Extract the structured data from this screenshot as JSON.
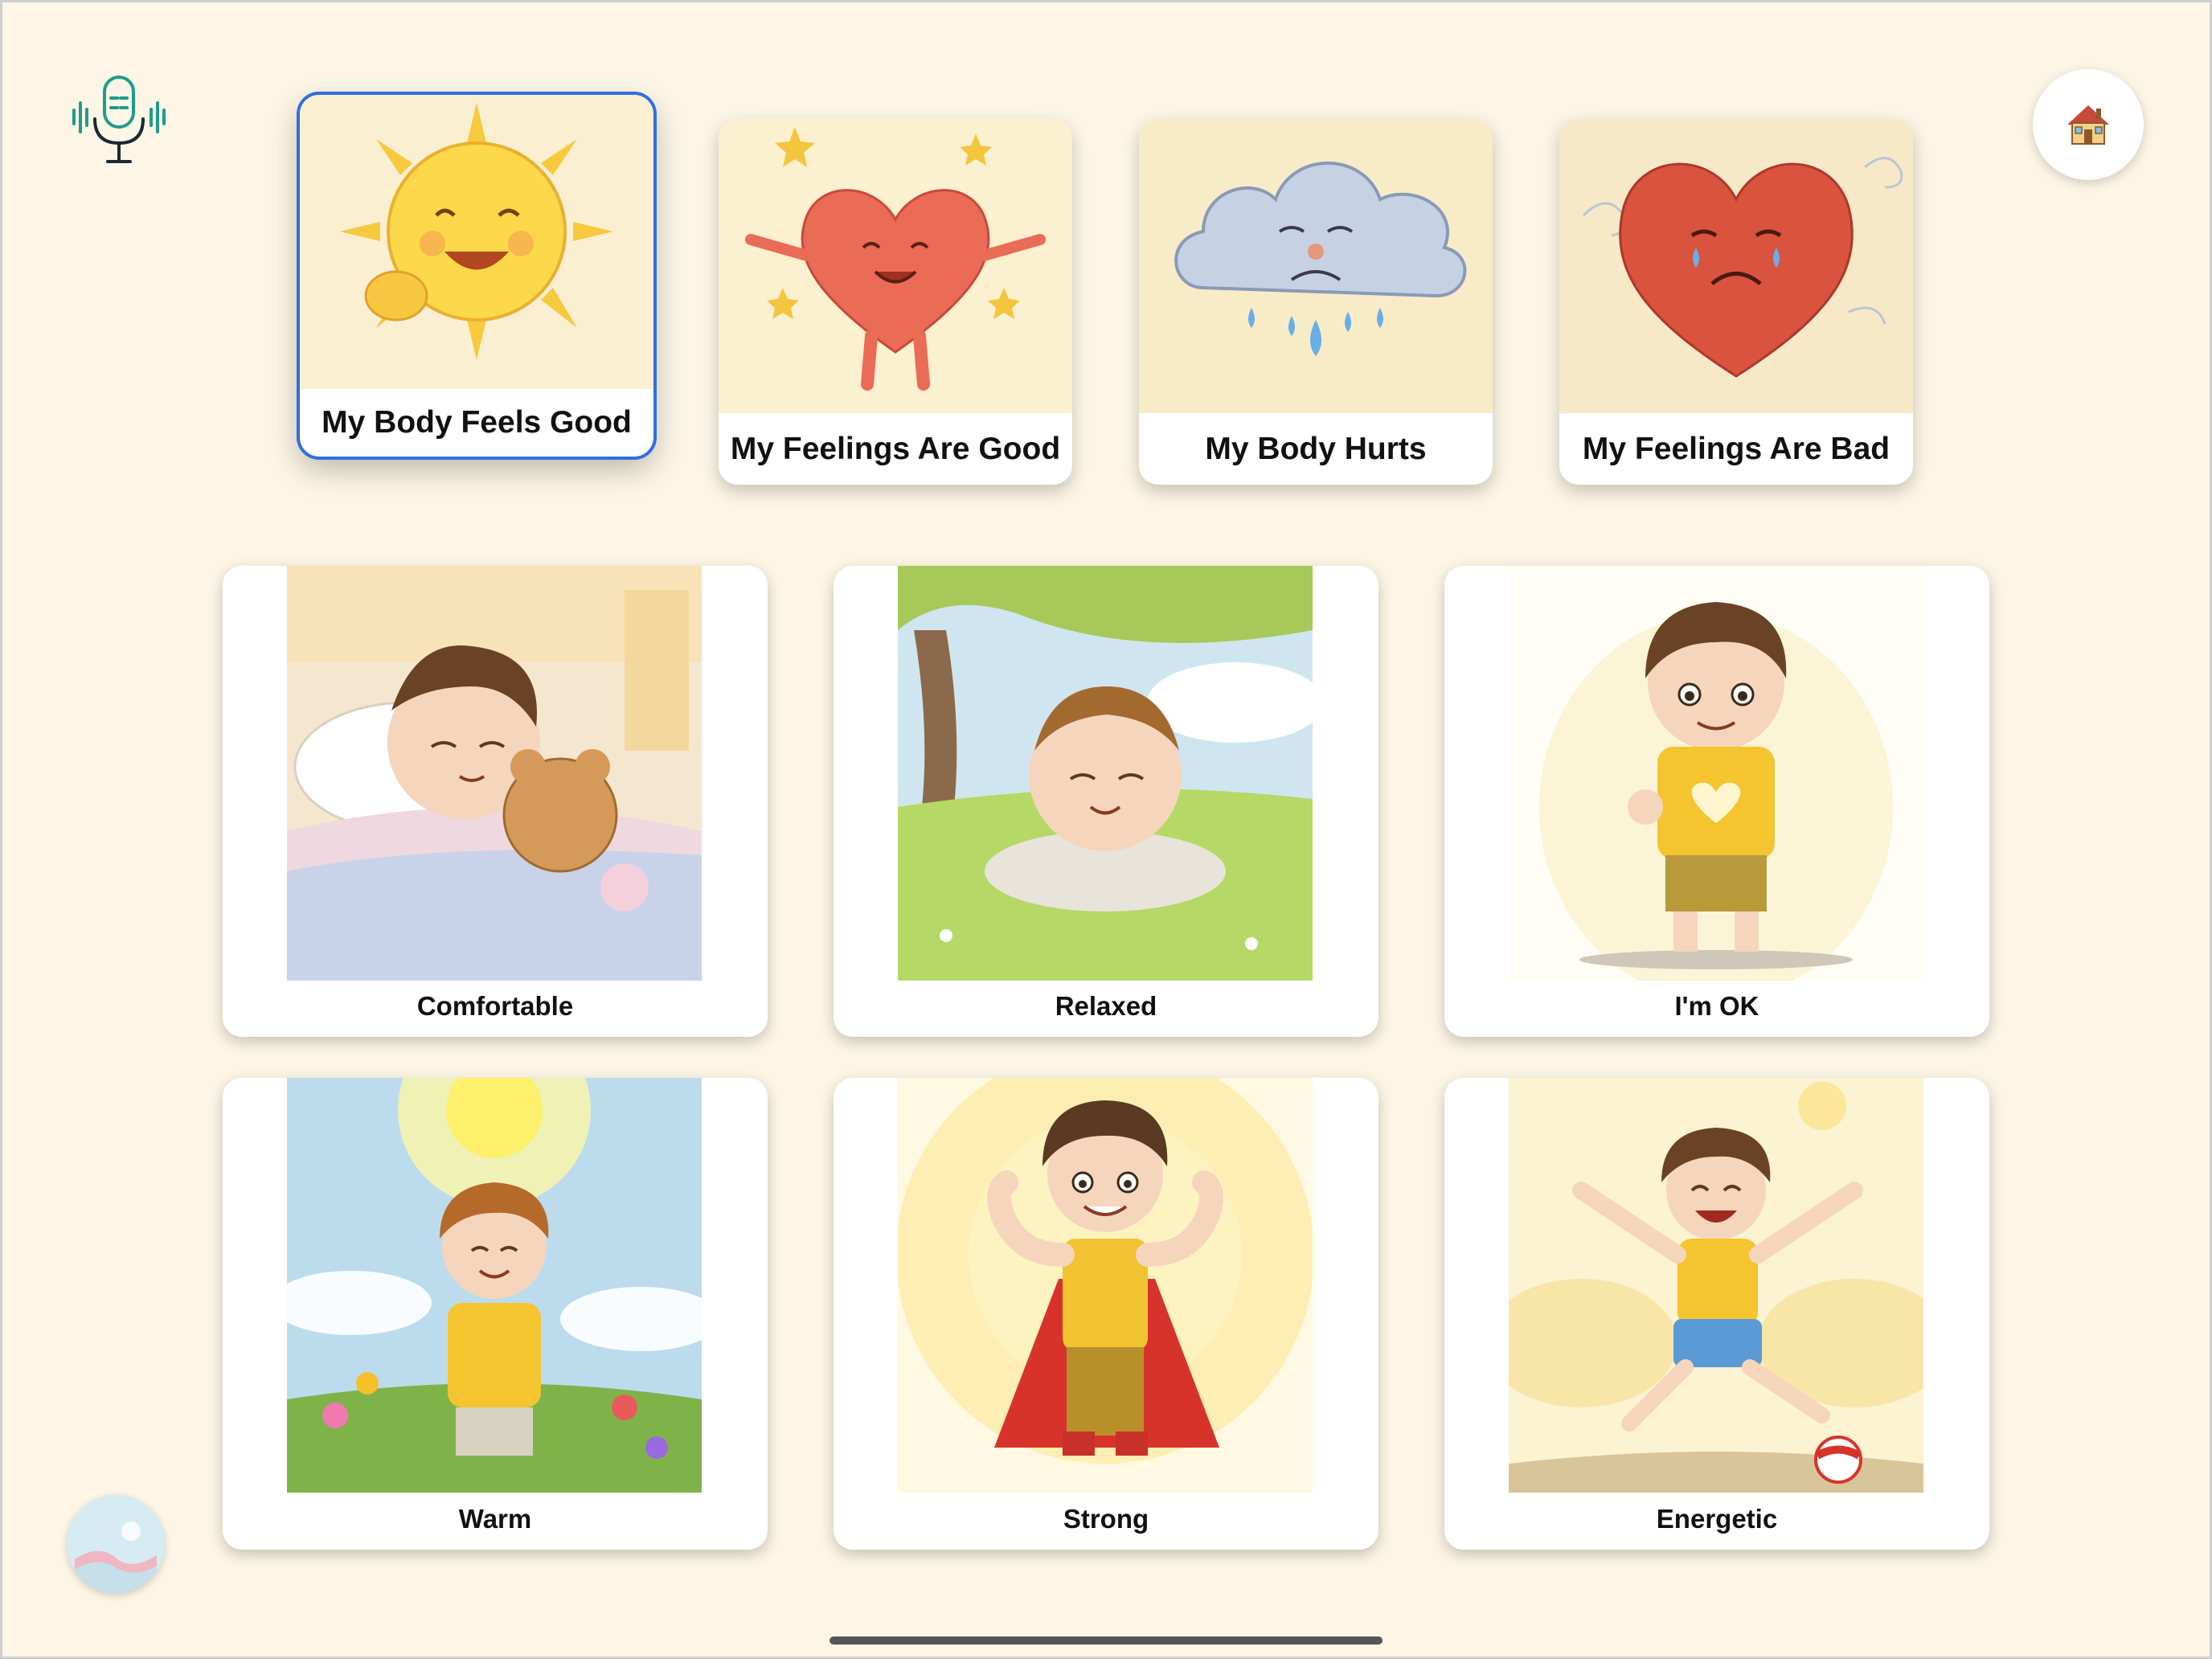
{
  "categories": [
    {
      "label": "My Body Feels Good",
      "selected": true
    },
    {
      "label": "My Feelings Are Good",
      "selected": false
    },
    {
      "label": "My Body Hurts",
      "selected": false
    },
    {
      "label": "My Feelings Are Bad",
      "selected": false
    }
  ],
  "feelings": [
    {
      "label": "Comfortable"
    },
    {
      "label": "Relaxed"
    },
    {
      "label": "I'm OK"
    },
    {
      "label": "Warm"
    },
    {
      "label": "Strong"
    },
    {
      "label": "Energetic"
    }
  ],
  "icons": {
    "mic": "microphone-icon",
    "home": "house-icon",
    "logo": "app-logo"
  },
  "colors": {
    "background": "#fdf6e6",
    "selection": "#2f6fe0",
    "mic": "#1e9c8a"
  }
}
